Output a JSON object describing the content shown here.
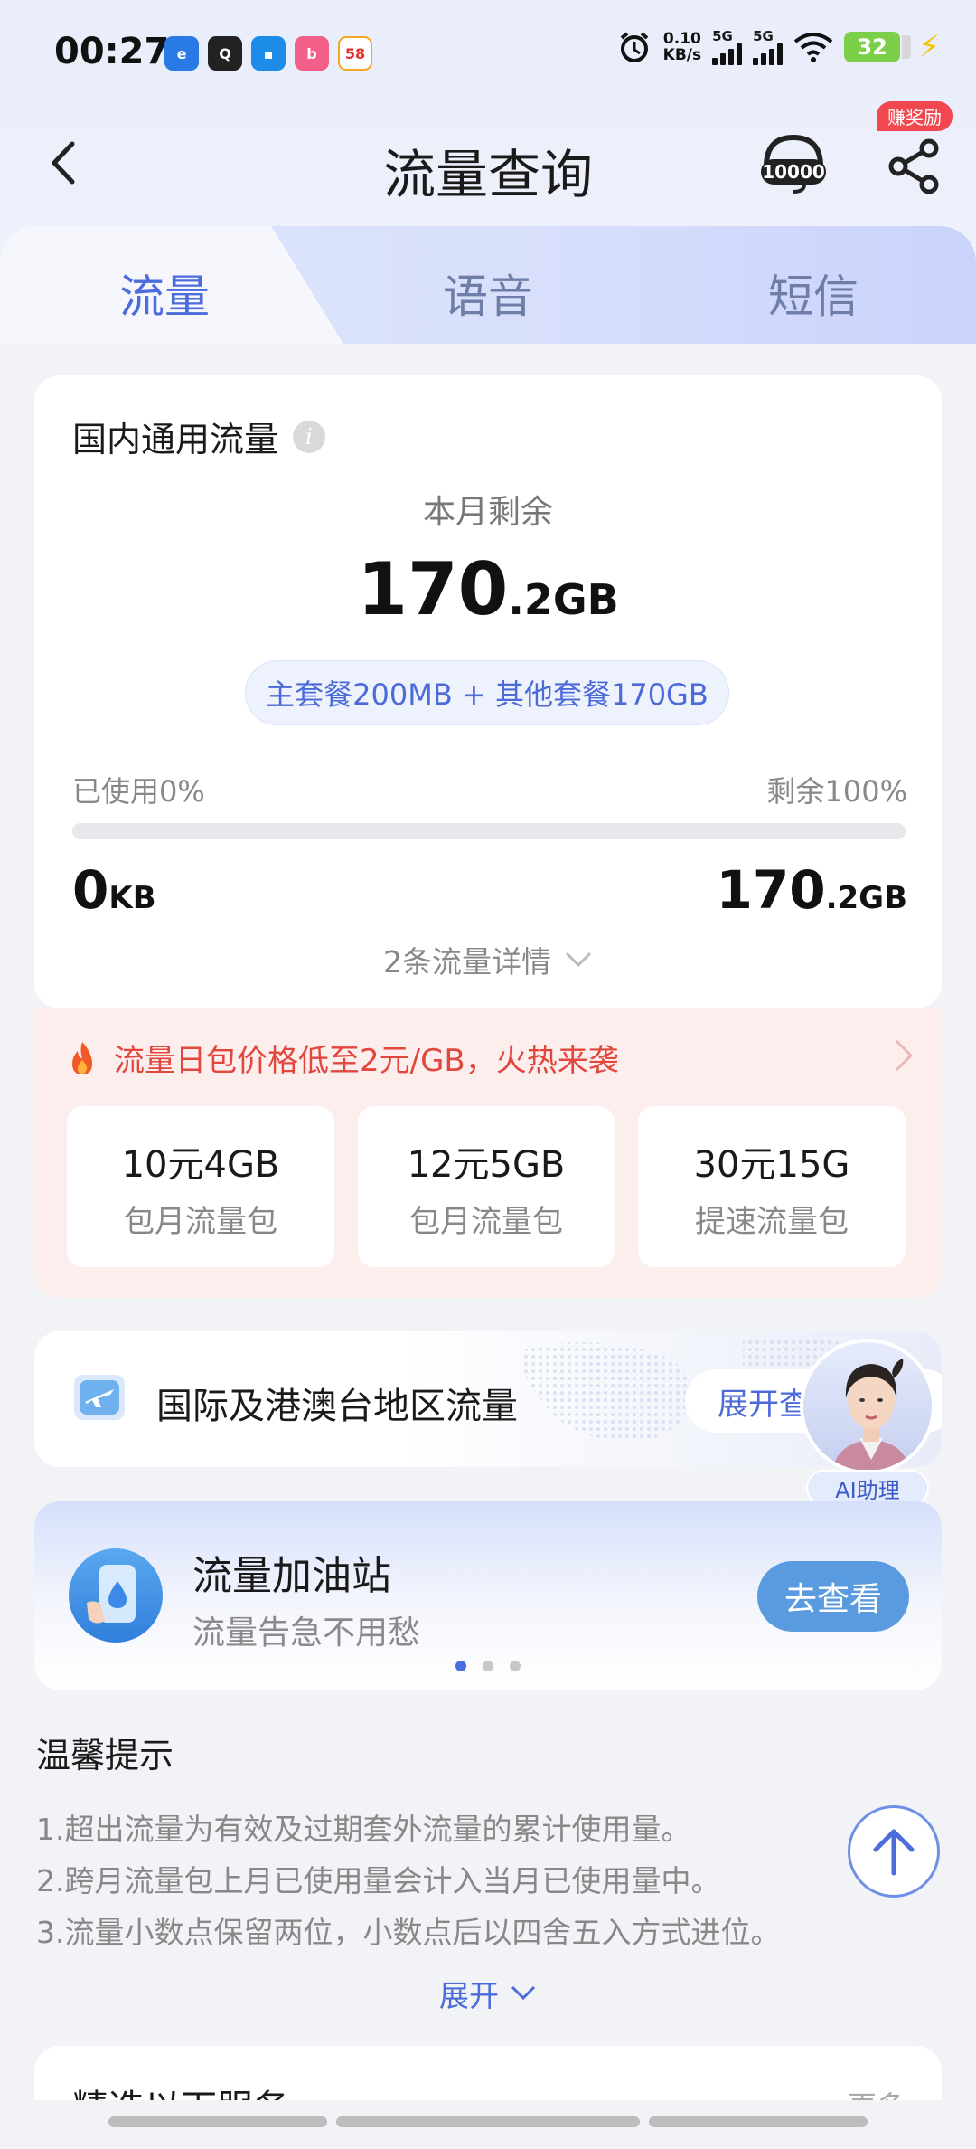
{
  "status_bar": {
    "time": "00:27",
    "net_speed_value": "0.10",
    "net_speed_unit": "KB/s",
    "signal1_label": "5G",
    "signal2_label": "5G",
    "battery": "32",
    "app_58_label": "58"
  },
  "header": {
    "title": "流量查询",
    "reward_badge": "赚奖励",
    "service_label": "10000"
  },
  "tabs": [
    {
      "label": "流量",
      "active": true
    },
    {
      "label": "语音",
      "active": false
    },
    {
      "label": "短信",
      "active": false
    }
  ],
  "data_card": {
    "title": "国内通用流量",
    "info_glyph": "i",
    "remain_label": "本月剩余",
    "remain_number": "170",
    "remain_unit": ".2GB",
    "package_summary": "主套餐200MB + 其他套餐170GB",
    "used_label": "已使用0%",
    "remain_percent_label": "剩余100%",
    "used_progress_fraction": 0.0,
    "used_number": "0",
    "used_unit": "KB",
    "remain_number_small": "170",
    "remain_unit_small": ".2GB",
    "details_link": "2条流量详情"
  },
  "promo": {
    "headline": "流量日包价格低至2元/GB，火热来袭",
    "packages": [
      {
        "name": "10元4GB",
        "type": "包月流量包"
      },
      {
        "name": "12元5GB",
        "type": "包月流量包"
      },
      {
        "name": "30元15G",
        "type": "提速流量包"
      }
    ]
  },
  "international": {
    "label": "国际及港澳台地区流量",
    "expand_label": "展开查"
  },
  "ai_assistant": {
    "label": "AI助理"
  },
  "refuel": {
    "title": "流量加油站",
    "subtitle": "流量告急不用愁",
    "button": "去查看",
    "active_dot": 0
  },
  "tips": {
    "title": "温馨提示",
    "items": [
      "1.超出流量为有效及过期套外流量的累计使用量。",
      "2.跨月流量包上月已使用量会计入当月已使用量中。",
      "3.流量小数点保留两位，小数点后以四舍五入方式进位。"
    ],
    "expand": "展开"
  },
  "bottom_section": {
    "title": "精选以下服务",
    "more": "更多"
  },
  "colors": {
    "accent": "#4c6cdc",
    "promo_red": "#e2473d",
    "button_blue": "#5a9be0"
  }
}
